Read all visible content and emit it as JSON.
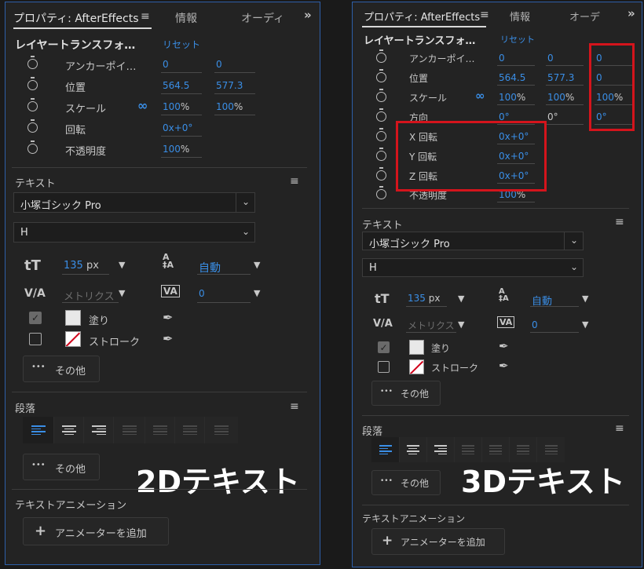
{
  "left": {
    "tabs": [
      "プロパティ: AfterEffects",
      "情報",
      "オーディ"
    ],
    "transform": {
      "title": "レイヤートランスフォ…",
      "reset": "リセット",
      "rows": [
        {
          "label": "アンカーポイ…",
          "v1": "0",
          "v2": "0"
        },
        {
          "label": "位置",
          "v1": "564.5",
          "v2": "577.3"
        },
        {
          "label": "スケール",
          "v1": "100",
          "v1_unit": "%",
          "v2": "100",
          "v2_unit": "%"
        },
        {
          "label": "回転",
          "v1": "0x+0°"
        },
        {
          "label": "不透明度",
          "v1": "100",
          "v1_unit": "%"
        }
      ]
    },
    "text": {
      "title": "テキスト",
      "font": "小塚ゴシック Pro",
      "style": "H",
      "size": "135",
      "size_unit": "px",
      "leading": "自動",
      "kerning": "メトリクス",
      "tracking": "0",
      "fill": "塗り",
      "stroke": "ストローク",
      "more": "その他"
    },
    "paragraph": {
      "title": "段落",
      "more": "その他"
    },
    "animation": {
      "title": "テキストアニメーション",
      "add": "アニメーターを追加"
    },
    "caption": "2Dテキスト"
  },
  "right": {
    "tabs": [
      "プロパティ: AfterEffects",
      "情報",
      "オーデ"
    ],
    "transform": {
      "title": "レイヤートランスフォ…",
      "reset": "リセット",
      "rows": [
        {
          "label": "アンカーポイ…",
          "v1": "0",
          "v2": "0",
          "v3": "0"
        },
        {
          "label": "位置",
          "v1": "564.5",
          "v2": "577.3",
          "v3": "0"
        },
        {
          "label": "スケール",
          "v1": "100",
          "v1_unit": "%",
          "v2": "100",
          "v2_unit": "%",
          "v3": "100",
          "v3_unit": "%"
        },
        {
          "label": "方向",
          "v1": "0°",
          "v2": "0°",
          "v3": "0°"
        },
        {
          "label": "X 回転",
          "v1": "0x+0°"
        },
        {
          "label": "Y 回転",
          "v1": "0x+0°"
        },
        {
          "label": "Z 回転",
          "v1": "0x+0°"
        },
        {
          "label": "不透明度",
          "v1": "100",
          "v1_unit": "%"
        }
      ]
    },
    "text": {
      "title": "テキスト",
      "font": "小塚ゴシック Pro",
      "style": "H",
      "size": "135",
      "size_unit": "px",
      "leading": "自動",
      "kerning": "メトリクス",
      "tracking": "0",
      "fill": "塗り",
      "stroke": "ストローク",
      "more": "その他"
    },
    "paragraph": {
      "title": "段落",
      "more": "その他"
    },
    "animation": {
      "title": "テキストアニメーション",
      "add": "アニメーターを追加"
    },
    "caption": "3Dテキスト"
  },
  "icons": {
    "menu": "≡",
    "overflow": "»",
    "chevron": "⌄",
    "dropdown_triangle": "▼",
    "more": "•••",
    "add": "+",
    "link": "∞",
    "check": "✓",
    "eyedropper": "✒",
    "font_size": "tT",
    "kerning": "V/A",
    "tracking": "VA"
  },
  "colors": {
    "accent": "#3a8ee6",
    "highlight_box": "#d4141c",
    "panel_border": "#2d5fa8"
  }
}
